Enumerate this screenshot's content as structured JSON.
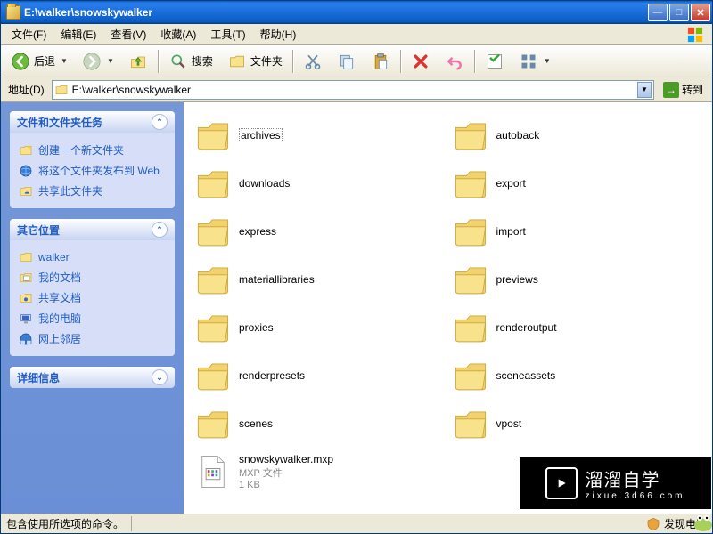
{
  "window": {
    "title": "E:\\walker\\snowskywalker"
  },
  "menu": {
    "file": "文件(F)",
    "edit": "编辑(E)",
    "view": "查看(V)",
    "favorites": "收藏(A)",
    "tools": "工具(T)",
    "help": "帮助(H)"
  },
  "toolbar": {
    "back": "后退",
    "search": "搜索",
    "folders": "文件夹"
  },
  "address": {
    "label": "地址(D)",
    "path": "E:\\walker\\snowskywalker",
    "go": "转到"
  },
  "sidebar": {
    "panel1": {
      "title": "文件和文件夹任务",
      "tasks": [
        {
          "icon": "folder-new",
          "label": "创建一个新文件夹"
        },
        {
          "icon": "web-publish",
          "label": "将这个文件夹发布到 Web"
        },
        {
          "icon": "share",
          "label": "共享此文件夹"
        }
      ]
    },
    "panel2": {
      "title": "其它位置",
      "tasks": [
        {
          "icon": "folder",
          "label": "walker"
        },
        {
          "icon": "mydocs",
          "label": "我的文档"
        },
        {
          "icon": "shareddocs",
          "label": "共享文档"
        },
        {
          "icon": "mycomputer",
          "label": "我的电脑"
        },
        {
          "icon": "network",
          "label": "网上邻居"
        }
      ]
    },
    "panel3": {
      "title": "详细信息"
    }
  },
  "folders_left": [
    "archives",
    "downloads",
    "express",
    "materiallibraries",
    "proxies",
    "renderpresets",
    "scenes"
  ],
  "folders_right": [
    "autoback",
    "export",
    "import",
    "previews",
    "renderoutput",
    "sceneassets",
    "vpost"
  ],
  "file": {
    "name": "snowskywalker.mxp",
    "type": "MXP 文件",
    "size": "1 KB"
  },
  "statusbar": {
    "text": "包含使用所选项的命令。",
    "tray": "发现电脑"
  },
  "watermark": {
    "brand": "溜溜自学",
    "sub": "zixue.3d66.com"
  }
}
